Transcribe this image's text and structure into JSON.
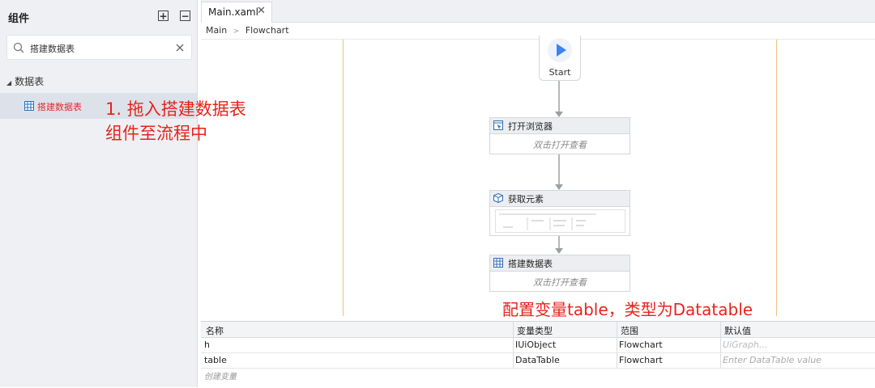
{
  "left_panel": {
    "title": "组件",
    "search_value": "搭建数据表",
    "category": "数据表",
    "item": "搭建数据表"
  },
  "annotation1": {
    "line1": "1. 拖入搭建数据表",
    "line2": "组件至流程中"
  },
  "annotation2": "配置变量table，类型为Datatable",
  "tab": {
    "label": "Main.xaml",
    "close": "✕"
  },
  "breadcrumb": {
    "root": "Main",
    "sep": ">",
    "current": "Flowchart"
  },
  "flow": {
    "start": "Start",
    "nodes": [
      {
        "name": "打开浏览器",
        "hint": "双击打开查看"
      },
      {
        "name": "获取元素"
      },
      {
        "name": "搭建数据表",
        "hint": "双击打开查看"
      }
    ]
  },
  "variables": {
    "headers": [
      "名称",
      "变量类型",
      "范围",
      "默认值"
    ],
    "rows": [
      {
        "name": "h",
        "type": "IUiObject",
        "scope": "Flowchart",
        "default": "UiGraph..."
      },
      {
        "name": "table",
        "type": "DataTable",
        "scope": "Flowchart",
        "default": "Enter DataTable value"
      }
    ],
    "create": "创建变量"
  },
  "colors": {
    "accent": "#e8231b",
    "start_icon": "#3b82f6",
    "lane": "#f0c080"
  }
}
